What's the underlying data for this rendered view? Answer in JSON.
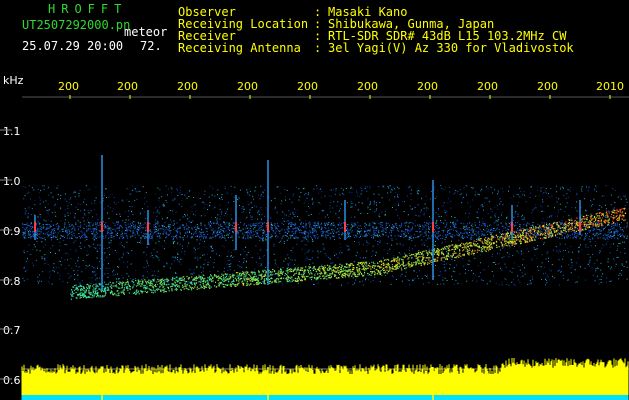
{
  "header": {
    "brand": "HROFFT",
    "filename": "UT2507292000.pn",
    "type": "meteor",
    "datetime": "25.07.29 20:00",
    "count": "72.",
    "fields": [
      {
        "key": "Observer",
        "value": "Masaki Kano"
      },
      {
        "key": "Receiving Location",
        "value": "Shibukawa, Gunma, Japan"
      },
      {
        "key": "Receiver",
        "value": "RTL-SDR SDR# 43dB L15 103.2MHz CW"
      },
      {
        "key": "Receiving Antenna",
        "value": "3el Yagi(V) Az 330 for Vladivostok"
      }
    ]
  },
  "axis": {
    "unit": "kHz",
    "y_ticks": [
      "1.1",
      "1.0",
      "0.9",
      "0.8",
      "0.7",
      "0.6"
    ],
    "x_ticks": [
      "200",
      "200",
      "200",
      "200",
      "200",
      "200",
      "200",
      "200",
      "200",
      "2010"
    ]
  },
  "colors": {
    "background": "#000000",
    "title_green": "#2fd92f",
    "axis_yellow": "#ffff00",
    "text_white": "#ffffff",
    "bar_cyan": "#00e0ff"
  }
}
